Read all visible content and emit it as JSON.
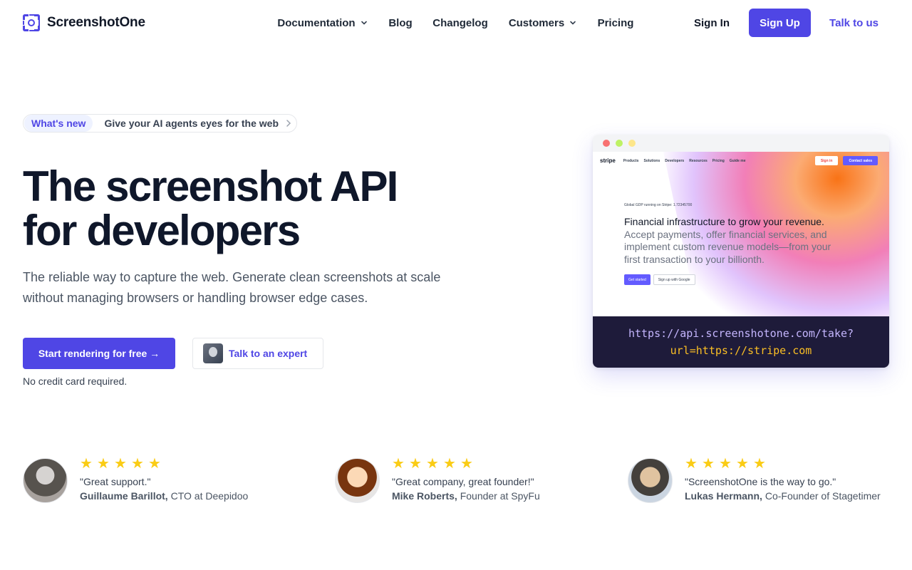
{
  "brand": {
    "name": "ScreenshotOne",
    "accent": "#4f46e5"
  },
  "nav": {
    "documentation": "Documentation",
    "blog": "Blog",
    "changelog": "Changelog",
    "customers": "Customers",
    "pricing": "Pricing"
  },
  "auth": {
    "sign_in": "Sign In",
    "sign_up": "Sign Up",
    "talk": "Talk to us"
  },
  "announcement": {
    "tag": "What's new",
    "text": "Give your AI agents eyes for the web"
  },
  "hero": {
    "title": "The screenshot API for developers",
    "subtitle": "The reliable way to capture the web. Generate clean screenshots at scale without managing browsers or handling browser edge cases.",
    "cta_primary": "Start rendering for free →",
    "cta_secondary": "Talk to an expert",
    "note": "No credit card required."
  },
  "preview": {
    "site_brand": "stripe",
    "site_nav": [
      "Products",
      "Solutions",
      "Developers",
      "Resources",
      "Pricing",
      "Guide me"
    ],
    "site_signin": "Sign in",
    "site_contact": "Contact sales",
    "site_small": "Global GDP running on Stripe: 1.72345700",
    "site_headline_strong": "Financial infrastructure to grow your revenue.",
    "site_headline_rest": "Accept payments, offer financial services, and implement custom revenue models—from your first transaction to your billionth.",
    "site_btn_primary": "Get started",
    "site_btn_secondary": "Sign up with Google",
    "url_line1": "https://api.screenshotone.com/take?",
    "url_line2": "url=https://stripe.com"
  },
  "testimonials": [
    {
      "stars": 5,
      "quote": "\"Great support.\"",
      "name": "Guillaume Barillot,",
      "role": "CTO at Deepidoo"
    },
    {
      "stars": 5,
      "quote": "\"Great company, great founder!\"",
      "name": "Mike Roberts,",
      "role": "Founder at SpyFu"
    },
    {
      "stars": 5,
      "quote": "\"ScreenshotOne is the way to go.\"",
      "name": "Lukas Hermann,",
      "role": "Co-Founder of Stagetimer"
    }
  ]
}
